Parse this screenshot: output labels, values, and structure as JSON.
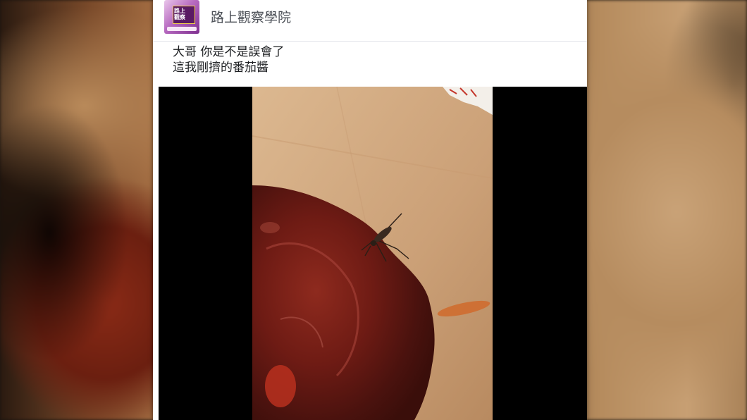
{
  "page": {
    "name": "路上觀察學院",
    "avatar_alt": "路上觀察學院"
  },
  "post": {
    "text_lines": [
      "大哥 你是不是誤會了",
      "這我剛擠的番茄醬"
    ]
  },
  "video": {
    "icon": "video-frame"
  }
}
